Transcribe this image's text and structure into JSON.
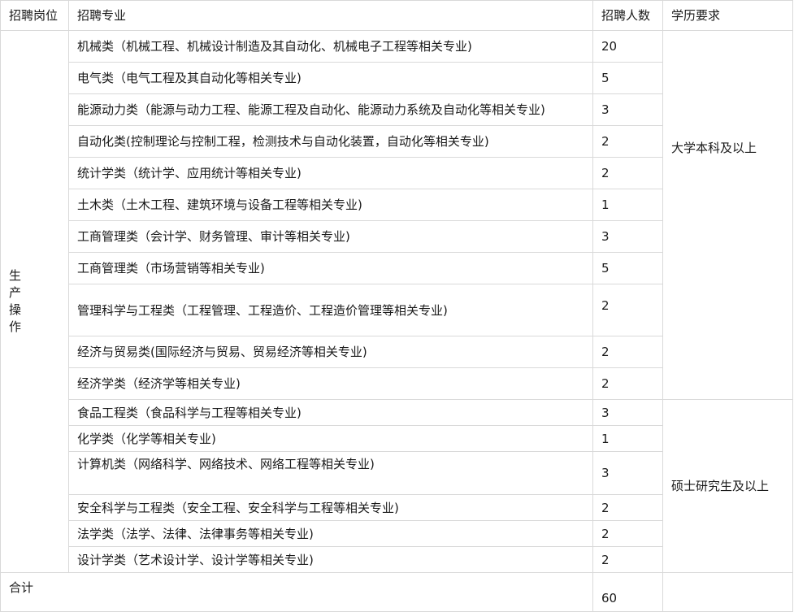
{
  "headers": [
    "招聘岗位",
    "招聘专业",
    "招聘人数",
    "学历要求"
  ],
  "position": "生产操作",
  "groups": [
    {
      "education": "大学本科及以上",
      "rows": [
        {
          "major": "机械类（机械工程、机械设计制造及其自动化、机械电子工程等相关专业)",
          "count": "20"
        },
        {
          "major": "电气类（电气工程及其自动化等相关专业)",
          "count": "5"
        },
        {
          "major": "能源动力类（能源与动力工程、能源工程及自动化、能源动力系统及自动化等相关专业)",
          "count": "3"
        },
        {
          "major": "自动化类(控制理论与控制工程，检测技术与自动化装置，自动化等相关专业)",
          "count": "2"
        },
        {
          "major": "统计学类（统计学、应用统计等相关专业)",
          "count": "2"
        },
        {
          "major": "土木类（土木工程、建筑环境与设备工程等相关专业)",
          "count": "1"
        },
        {
          "major": "工商管理类（会计学、财务管理、审计等相关专业)",
          "count": "3"
        },
        {
          "major": "工商管理类（市场营销等相关专业)",
          "count": "5"
        },
        {
          "major": "管理科学与工程类（工程管理、工程造价、工程造价管理等相关专业)",
          "count": "2"
        },
        {
          "major": "经济与贸易类(国际经济与贸易、贸易经济等相关专业)",
          "count": "2"
        },
        {
          "major": "经济学类（经济学等相关专业)",
          "count": "2"
        }
      ]
    },
    {
      "education": "硕士研究生及以上",
      "rows": [
        {
          "major": "食品工程类（食品科学与工程等相关专业)",
          "count": "3"
        },
        {
          "major": "化学类（化学等相关专业)",
          "count": "1"
        },
        {
          "major": "计算机类（网络科学、网络技术、网络工程等相关专业)",
          "count": "3"
        },
        {
          "major": "安全科学与工程类（安全工程、安全科学与工程等相关专业)",
          "count": "2"
        },
        {
          "major": "法学类（法学、法律、法律事务等相关专业)",
          "count": "2"
        },
        {
          "major": "设计学类（艺术设计学、设计学等相关专业)",
          "count": "2"
        }
      ]
    }
  ],
  "total": {
    "label": "合计",
    "count": "60"
  }
}
